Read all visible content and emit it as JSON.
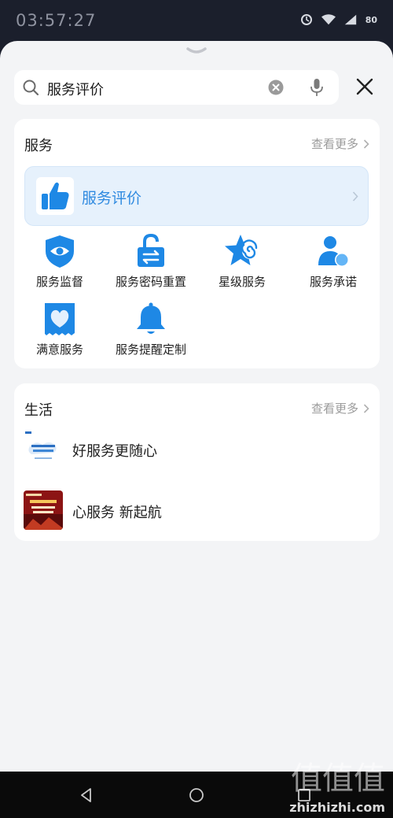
{
  "status_bar": {
    "time": "03:57:27",
    "battery": "80"
  },
  "search": {
    "query": "服务评价"
  },
  "services_card": {
    "title": "服务",
    "more": "查看更多",
    "featured": {
      "label": "服务评价",
      "icon": "thumbs-up-icon"
    },
    "items": [
      {
        "label": "服务监督",
        "icon": "shield-eye-icon"
      },
      {
        "label": "服务密码重置",
        "icon": "lock-exchange-icon"
      },
      {
        "label": "星级服务",
        "icon": "star-icon"
      },
      {
        "label": "服务承诺",
        "icon": "user-badge-icon"
      },
      {
        "label": "满意服务",
        "icon": "heart-ticket-icon"
      },
      {
        "label": "服务提醒定制",
        "icon": "bell-icon"
      }
    ]
  },
  "life_card": {
    "title": "生活",
    "more": "查看更多",
    "items": [
      {
        "label": "好服务更随心"
      },
      {
        "label": "心服务 新起航"
      }
    ]
  },
  "watermark": {
    "glyphs": "值值值",
    "url": "zhizhizhi.com"
  },
  "colors": {
    "accent": "#2f8ae0",
    "icon_blue": "#1e88e5",
    "featured_bg": "#e6f1fc"
  }
}
